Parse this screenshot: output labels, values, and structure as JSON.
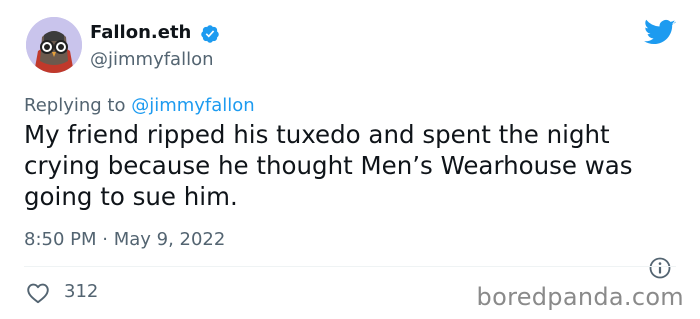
{
  "author": {
    "display_name": "Fallon.eth",
    "handle": "@jimmyfallon",
    "verified": true,
    "avatar_icon": "owl-nft-avatar-icon"
  },
  "reply": {
    "prefix": "Replying to ",
    "mention": "@jimmyfallon"
  },
  "tweet": {
    "text": "My friend ripped his tuxedo and spent the night crying because he thought Men’s Wearhouse was going to sue him.",
    "timestamp": "8:50 PM · May 9, 2022"
  },
  "actions": {
    "like_count": "312"
  },
  "watermark": "boredpanda.com",
  "colors": {
    "accent": "#1d9bf0",
    "text": "#0f1419",
    "secondary_text": "#536471"
  }
}
